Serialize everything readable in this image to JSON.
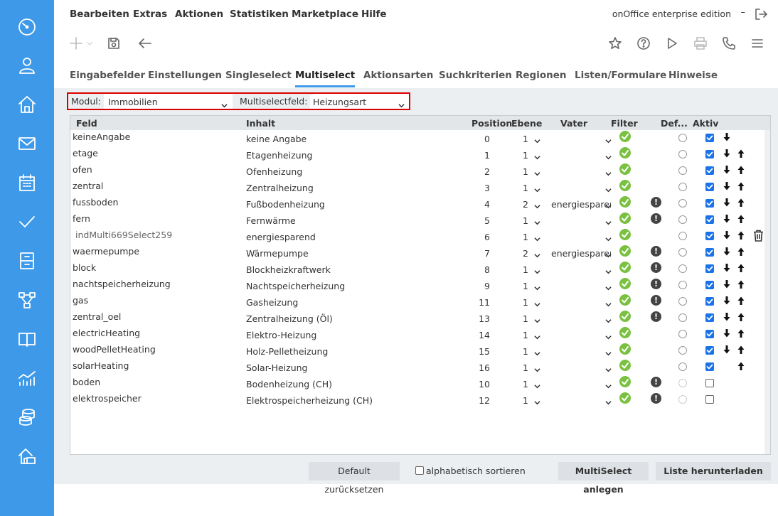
{
  "sidebar": {
    "icons": [
      "dashboard-icon",
      "user-icon",
      "home-icon",
      "mail-icon",
      "calendar-icon",
      "check-icon",
      "cabinet-icon",
      "network-icon",
      "book-icon",
      "statistics-icon",
      "database-icon",
      "property-icon"
    ]
  },
  "menu": {
    "items": [
      "Bearbeiten",
      "Extras",
      "Aktionen",
      "Statistiken",
      "Marketplace",
      "Hilfe"
    ],
    "edition": "onOffice enterprise edition",
    "dash": "–"
  },
  "tabs": {
    "items": [
      "Eingabefelder",
      "Einstellungen",
      "Singleselect",
      "Multiselect",
      "Aktionsarten",
      "Suchkriterien",
      "Regionen",
      "Listen/Formulare",
      "Hinweise"
    ],
    "active": "Multiselect"
  },
  "filter": {
    "modul_label": "Modul:",
    "modul_value": "Immobilien",
    "field_label": "Multiselectfeld:",
    "field_value": "Heizungsart"
  },
  "table": {
    "headers": [
      "Feld",
      "Inhalt",
      "Position",
      "Ebene",
      "Vater",
      "Filter",
      "Def...",
      "Aktiv"
    ],
    "rows": [
      {
        "feld": "keineAngabe",
        "inhalt": "keine Angabe",
        "pos": "0",
        "ebene": "1",
        "vater": "",
        "warn": false,
        "aktiv": true,
        "down": true,
        "up": false
      },
      {
        "feld": "etage",
        "inhalt": "Etagenheizung",
        "pos": "1",
        "ebene": "1",
        "vater": "",
        "warn": false,
        "aktiv": true,
        "down": true,
        "up": true
      },
      {
        "feld": "ofen",
        "inhalt": "Ofenheizung",
        "pos": "2",
        "ebene": "1",
        "vater": "",
        "warn": false,
        "aktiv": true,
        "down": true,
        "up": true
      },
      {
        "feld": "zentral",
        "inhalt": "Zentralheizung",
        "pos": "3",
        "ebene": "1",
        "vater": "",
        "warn": false,
        "aktiv": true,
        "down": true,
        "up": true
      },
      {
        "feld": "fussboden",
        "inhalt": "Fußbodenheizung",
        "pos": "4",
        "ebene": "2",
        "vater": "energiesparend",
        "warn": true,
        "aktiv": true,
        "down": true,
        "up": true
      },
      {
        "feld": "fern",
        "inhalt": "Fernwärme",
        "pos": "5",
        "ebene": "1",
        "vater": "",
        "warn": true,
        "aktiv": true,
        "down": true,
        "up": true
      },
      {
        "feld": "indMulti669Select259",
        "inhalt": "energiesparend",
        "pos": "6",
        "ebene": "1",
        "vater": "",
        "warn": false,
        "aktiv": true,
        "down": true,
        "up": true,
        "trash": true,
        "indent": true
      },
      {
        "feld": "waermepumpe",
        "inhalt": "Wärmepumpe",
        "pos": "7",
        "ebene": "2",
        "vater": "energiesparend",
        "warn": true,
        "aktiv": true,
        "down": true,
        "up": true
      },
      {
        "feld": "block",
        "inhalt": "Blockheizkraftwerk",
        "pos": "8",
        "ebene": "1",
        "vater": "",
        "warn": true,
        "aktiv": true,
        "down": true,
        "up": true
      },
      {
        "feld": "nachtspeicherheizung",
        "inhalt": "Nachtspeicherheizung",
        "pos": "9",
        "ebene": "1",
        "vater": "",
        "warn": true,
        "aktiv": true,
        "down": true,
        "up": true
      },
      {
        "feld": "gas",
        "inhalt": "Gasheizung",
        "pos": "11",
        "ebene": "1",
        "vater": "",
        "warn": true,
        "aktiv": true,
        "down": true,
        "up": true
      },
      {
        "feld": "zentral_oel",
        "inhalt": "Zentralheizung (Öl)",
        "pos": "13",
        "ebene": "1",
        "vater": "",
        "warn": true,
        "aktiv": true,
        "down": true,
        "up": true
      },
      {
        "feld": "electricHeating",
        "inhalt": "Elektro-Heizung",
        "pos": "14",
        "ebene": "1",
        "vater": "",
        "warn": false,
        "aktiv": true,
        "down": true,
        "up": true
      },
      {
        "feld": "woodPelletHeating",
        "inhalt": "Holz-Pelletheizung",
        "pos": "15",
        "ebene": "1",
        "vater": "",
        "warn": false,
        "aktiv": true,
        "down": true,
        "up": true
      },
      {
        "feld": "solarHeating",
        "inhalt": "Solar-Heizung",
        "pos": "16",
        "ebene": "1",
        "vater": "",
        "warn": false,
        "aktiv": true,
        "down": false,
        "up": true
      },
      {
        "feld": "boden",
        "inhalt": "Bodenheizung (CH)",
        "pos": "10",
        "ebene": "1",
        "vater": "",
        "warn": true,
        "aktiv": false,
        "down": false,
        "up": false,
        "radiodim": true
      },
      {
        "feld": "elektrospeicher",
        "inhalt": "Elektrospeicherheizung (CH)",
        "pos": "12",
        "ebene": "1",
        "vater": "",
        "warn": true,
        "aktiv": false,
        "down": false,
        "up": false,
        "radiodim": true
      }
    ]
  },
  "bottom": {
    "reset_label": "Default zurücksetzen",
    "alpha_label": "alphabetisch sortieren",
    "create_label": "MultiSelect anlegen",
    "download_label": "Liste herunterladen"
  },
  "colors": {
    "sidebar": "#3e9ae8",
    "accent": "#3e9ae8",
    "filter_ok": "#7ac142",
    "highlight_border": "#dd0000"
  }
}
